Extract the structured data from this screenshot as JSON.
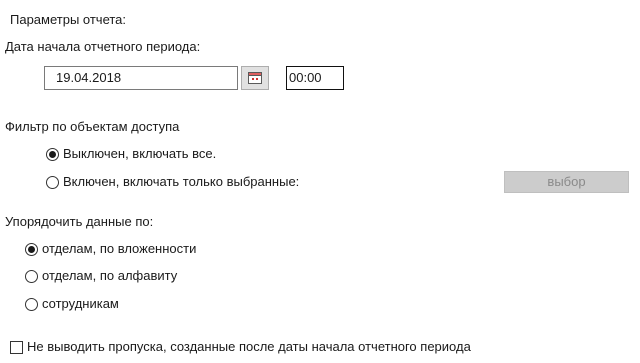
{
  "section_title": "Параметры отчета:",
  "start_date": {
    "label": "Дата начала отчетного периода:",
    "date_value": "19.04.2018",
    "time_value": "00:00",
    "calendar_icon": "calendar-icon"
  },
  "access_filter": {
    "label": "Фильтр по объектам доступа",
    "options": [
      {
        "label": "Выключен, включать все.",
        "checked": true
      },
      {
        "label": "Включен, включать только выбранные:",
        "checked": false
      }
    ],
    "select_button": "выбор"
  },
  "sort_by": {
    "label": "Упорядочить данные по:",
    "options": [
      {
        "label": "отделам, по вложенности",
        "checked": true
      },
      {
        "label": "отделам, по алфавиту",
        "checked": false
      },
      {
        "label": "сотрудникам",
        "checked": false
      }
    ]
  },
  "exclude_passes": {
    "label": "Не выводить пропуска, созданные после даты начала отчетного периода",
    "checked": false
  }
}
